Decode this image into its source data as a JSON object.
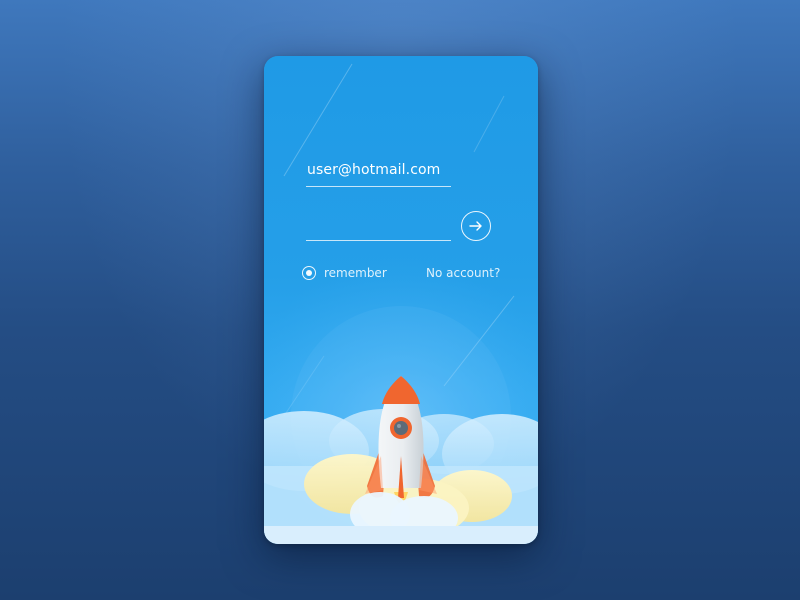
{
  "login": {
    "email_value": "user@hotmail.com",
    "password_value": "",
    "remember_label": "remember",
    "remember_checked": true,
    "no_account_label": "No account?"
  },
  "icons": {
    "submit": "arrow-right-icon",
    "remember": "radio-icon",
    "illustration": "rocket-icon"
  },
  "colors": {
    "card_top": "#1f9ae6",
    "card_bottom": "#3db0f2",
    "rocket_orange": "#f0662f",
    "background": "#2f5f9d"
  }
}
